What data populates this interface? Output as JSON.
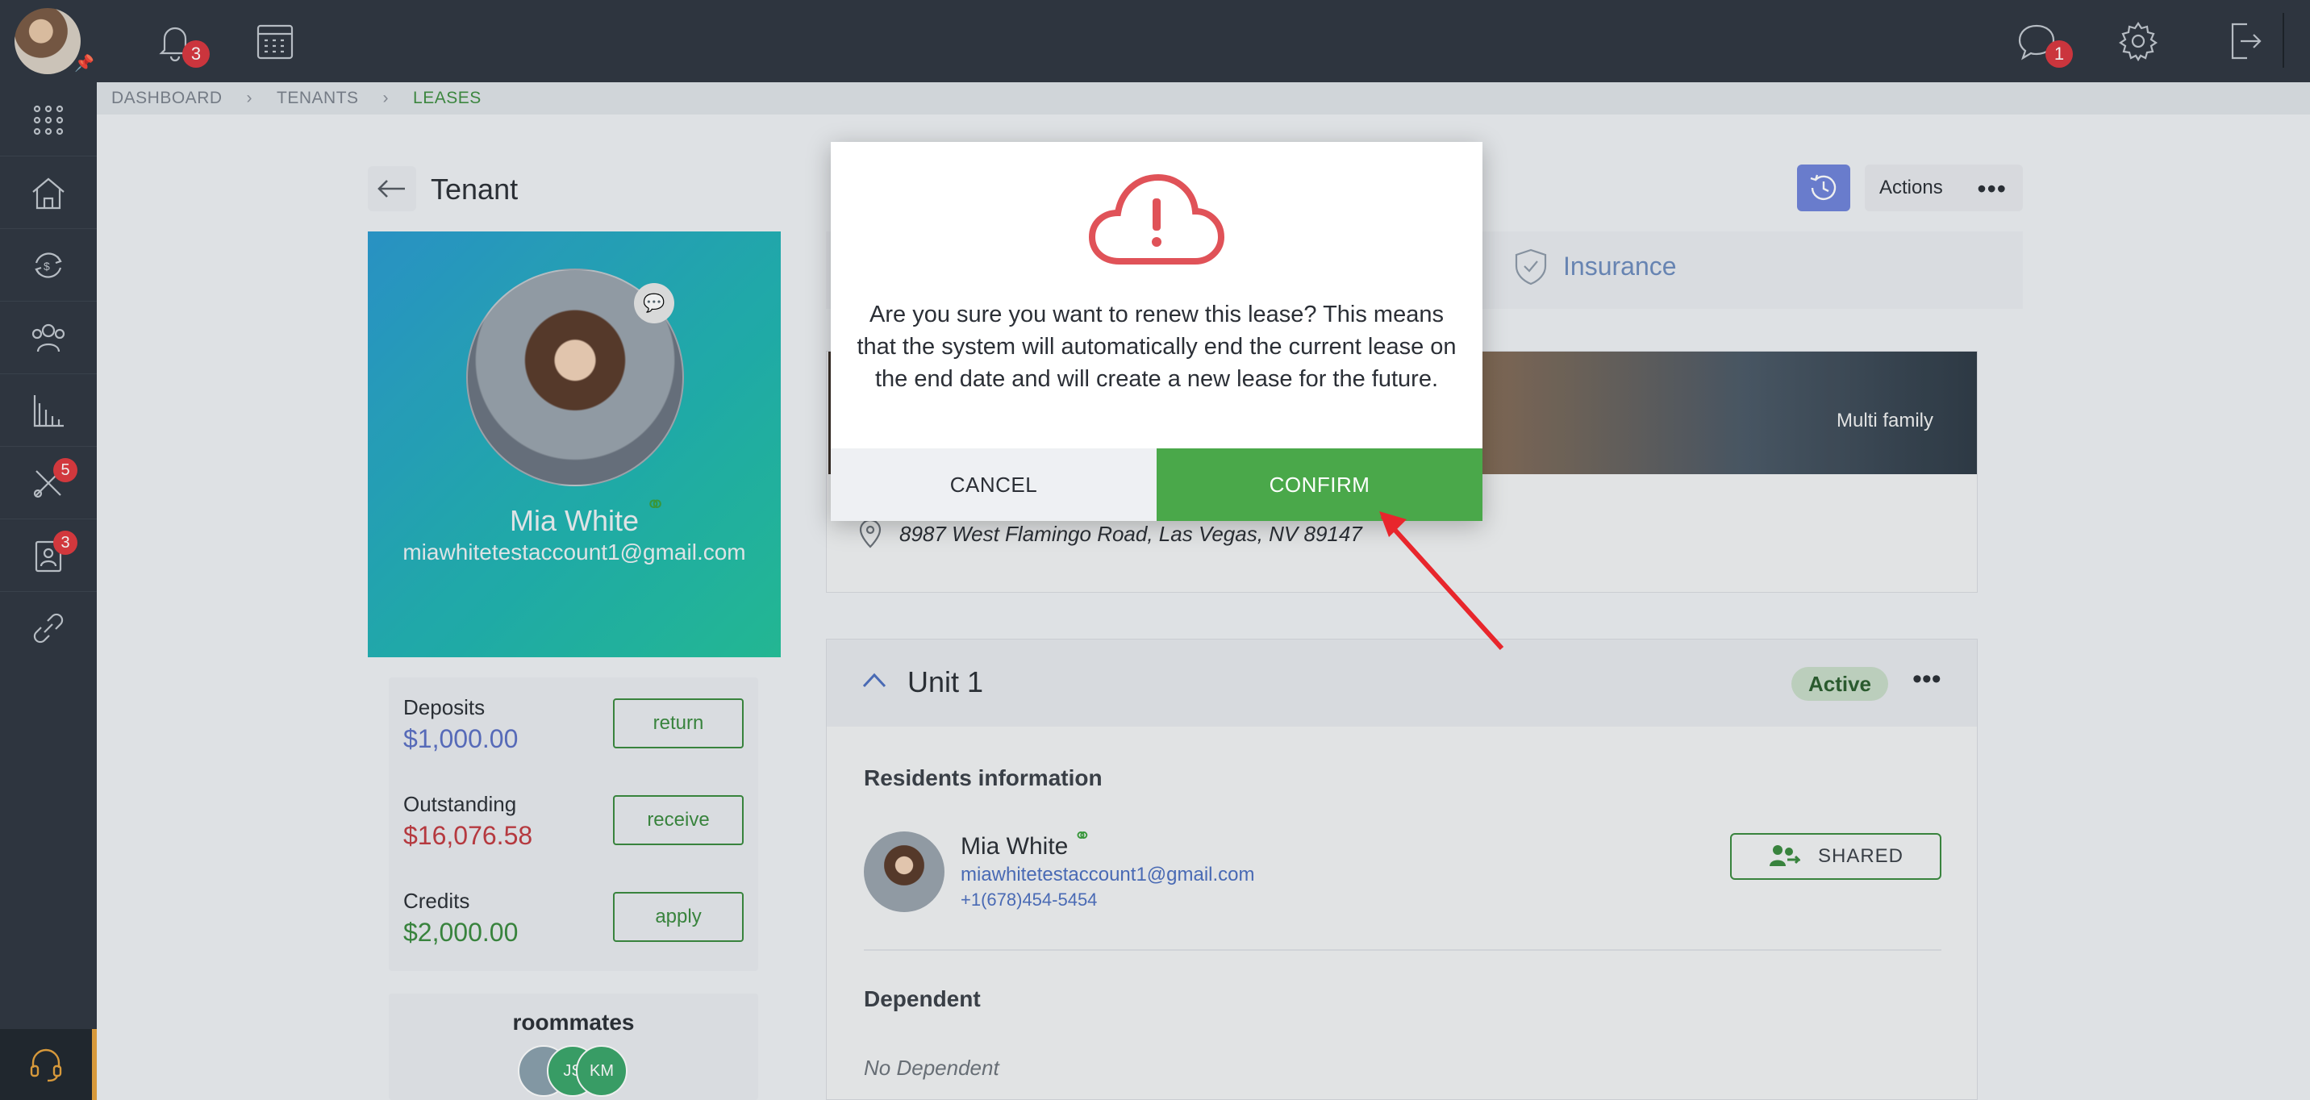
{
  "topbar": {
    "notifications_count": "3",
    "messages_count": "1"
  },
  "sidebar": {
    "maintenance_count": "5",
    "applicants_count": "3"
  },
  "breadcrumb": [
    "DASHBOARD",
    "TENANTS",
    "LEASES"
  ],
  "page": {
    "title": "Tenant",
    "actions_label": "Actions"
  },
  "profile": {
    "name": "Mia White",
    "email": "miawhitetestaccount1@gmail.com"
  },
  "balances": {
    "deposits_label": "Deposits",
    "deposits_value": "$1,000.00",
    "deposits_action": "return",
    "outstanding_label": "Outstanding",
    "outstanding_value": "$16,076.58",
    "outstanding_action": "receive",
    "credits_label": "Credits",
    "credits_value": "$2,000.00",
    "credits_action": "apply"
  },
  "roommates": {
    "title": "roommates",
    "avatars": [
      "JS",
      "KM"
    ]
  },
  "tabs": {
    "insurance": "Insurance"
  },
  "property": {
    "type_label": "Multi family",
    "address": "8987 West Flamingo Road, Las Vegas, NV 89147"
  },
  "unit": {
    "title": "Unit 1",
    "status": "Active",
    "residents_title": "Residents information",
    "resident_name": "Mia White",
    "resident_email": "miawhitetestaccount1@gmail.com",
    "resident_phone": "+1(678)454-5454",
    "shared_label": "SHARED",
    "dependent_title": "Dependent",
    "no_dependent": "No Dependent"
  },
  "modal": {
    "message": "Are you sure you want to renew this lease? This means that the system will automatically end the current lease on the end date and will create a new lease for the future.",
    "cancel_label": "CANCEL",
    "confirm_label": "CONFIRM"
  },
  "colors": {
    "primary_green": "#4aa84a",
    "danger_red": "#d9363e",
    "accent_blue": "#6f83d9",
    "sidebar_bg": "#2f3640"
  }
}
